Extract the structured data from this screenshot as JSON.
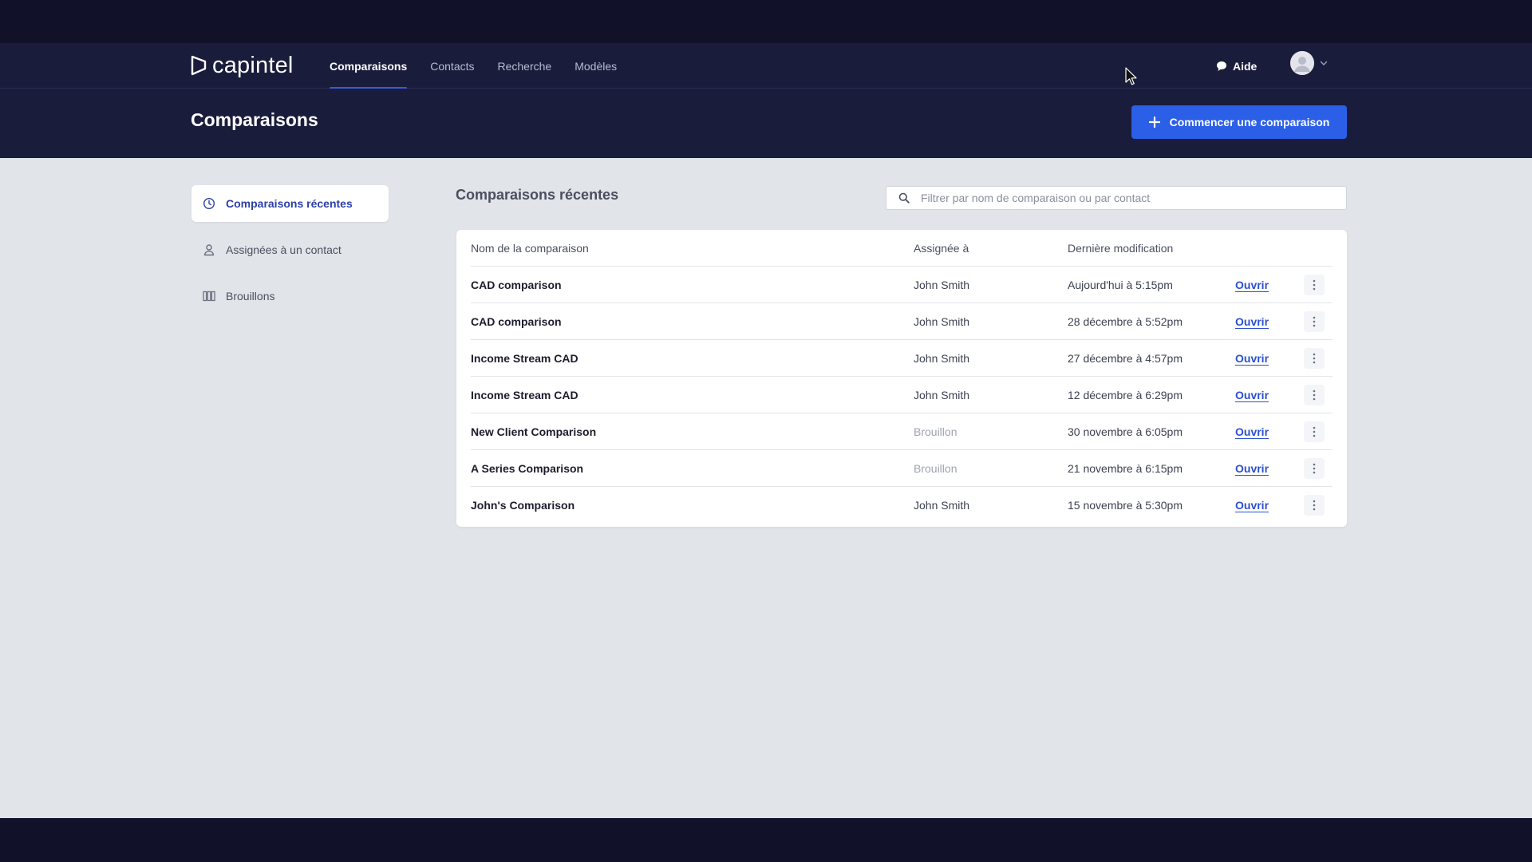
{
  "nav": {
    "logo_text": "capintel",
    "links": [
      {
        "label": "Comparaisons",
        "active": true
      },
      {
        "label": "Contacts",
        "active": false
      },
      {
        "label": "Recherche",
        "active": false
      },
      {
        "label": "Modèles",
        "active": false
      }
    ],
    "help_label": "Aide",
    "help_icon": "chat-bubble-icon",
    "user_icon": "avatar-icon"
  },
  "header": {
    "title": "Comparaisons",
    "primary_button_label": "Commencer une comparaison",
    "primary_button_icon": "plus-icon"
  },
  "sidebar": {
    "items": [
      {
        "label": "Comparaisons récentes",
        "icon": "clock-icon",
        "active": true
      },
      {
        "label": "Assignées à un contact",
        "icon": "person-icon",
        "active": false
      },
      {
        "label": "Brouillons",
        "icon": "columns-icon",
        "active": false
      }
    ]
  },
  "main": {
    "section_title": "Comparaisons récentes",
    "search_placeholder": "Filtrer par nom de comparaison ou par contact",
    "table": {
      "columns": [
        "Nom de la comparaison",
        "Assignée à",
        "Dernière modification"
      ],
      "open_label": "Ouvrir",
      "rows": [
        {
          "name": "CAD comparison",
          "assigned": "John Smith",
          "modified": "Aujourd'hui à 5:15pm",
          "draft": false
        },
        {
          "name": "CAD comparison",
          "assigned": "John Smith",
          "modified": "28 décembre à 5:52pm",
          "draft": false
        },
        {
          "name": "Income Stream CAD",
          "assigned": "John Smith",
          "modified": "27 décembre à 4:57pm",
          "draft": false
        },
        {
          "name": "Income Stream CAD",
          "assigned": "John Smith",
          "modified": "12 décembre à 6:29pm",
          "draft": false
        },
        {
          "name": "New Client Comparison",
          "assigned": "Brouillon",
          "modified": "30 novembre à 6:05pm",
          "draft": true
        },
        {
          "name": "A Series Comparison",
          "assigned": "Brouillon",
          "modified": "21 novembre à 6:15pm",
          "draft": true
        },
        {
          "name": "John's Comparison",
          "assigned": "John Smith",
          "modified": "15 novembre à 5:30pm",
          "draft": false
        }
      ]
    }
  },
  "colors": {
    "nav_bg": "#1a1c3b",
    "accent": "#2b5fe8",
    "link": "#2b4fd0",
    "page_bg": "#e1e4e8"
  }
}
